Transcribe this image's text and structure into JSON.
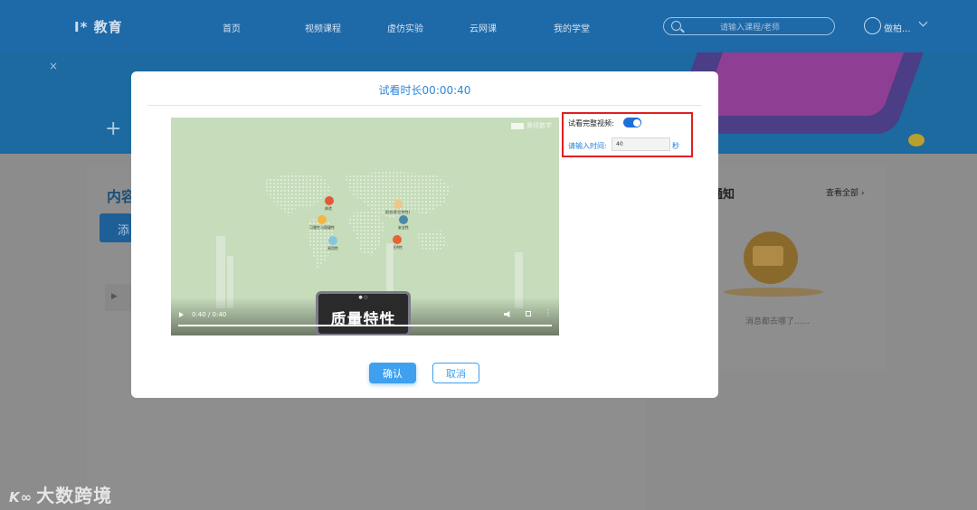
{
  "header": {
    "logo": "I* 教育",
    "nav": [
      "首页",
      "视频课程",
      "虚仿实验",
      "云网课",
      "我的学堂"
    ],
    "search_placeholder": "请输入课程/老师",
    "user_name": "做柏..."
  },
  "content_card": {
    "title": "内容",
    "add_button": "添"
  },
  "notice_card": {
    "title": "通知",
    "view_all": "查看全部 ›",
    "empty_text": "消息都去哪了......"
  },
  "modal": {
    "title": "试看时长00:00:40",
    "video": {
      "brand": "奥纽数学",
      "poi_labels": [
        "体验",
        "职务(职位特性)",
        "可靠性与稳健性",
        "安全性",
        "易用性",
        "经济性"
      ],
      "sign_top": "● ○",
      "sign_text": "质量特性",
      "time_display": "0:40 / 0:40",
      "progress": 1.0
    },
    "settings": {
      "full_video_label": "试看完整视频:",
      "full_video_enabled": true,
      "time_label": "请输入时间:",
      "time_value": "40",
      "time_unit": "秒"
    },
    "confirm_label": "确认",
    "cancel_label": "取消"
  },
  "watermark": "大数跨境"
}
